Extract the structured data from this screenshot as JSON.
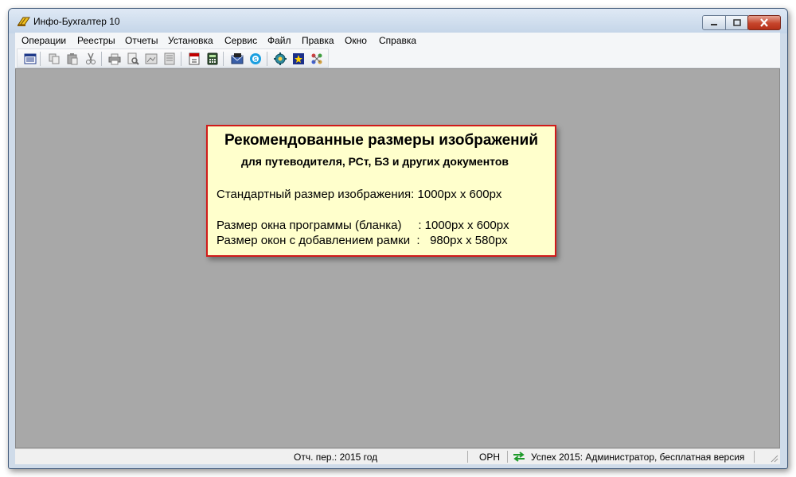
{
  "window": {
    "title": "Инфо-Бухгалтер 10"
  },
  "menu": {
    "items": [
      "Операции",
      "Реестры",
      "Отчеты",
      "Установка",
      "Сервис",
      "Файл",
      "Правка",
      "Окно",
      "Справка"
    ]
  },
  "toolbar": {
    "icons": [
      "list-view-icon",
      "copy-icon",
      "paste-icon",
      "cut-icon",
      "print-icon",
      "print-preview-icon",
      "image-icon",
      "form-icon",
      "pdf-document-icon",
      "calculator-icon",
      "mail-icon",
      "skype-icon",
      "settings-gear-icon",
      "star-image-icon",
      "network-icon"
    ]
  },
  "notice": {
    "title": "Рекомендованные размеры изображений",
    "subtitle": "для путеводителя, РСт, БЗ и других документов",
    "line1": "Стандартный размер изображения: 1000px x 600px",
    "line2": "Размер окна программы (бланка)     : 1000px x 600px",
    "line3": "Размер окон с добавлением рамки  :   980px x 580px"
  },
  "statusbar": {
    "period": "Отч. пер.: 2015 год",
    "mode": "ОРН",
    "user": "Успех 2015: Администратор, бесплатная версия"
  }
}
